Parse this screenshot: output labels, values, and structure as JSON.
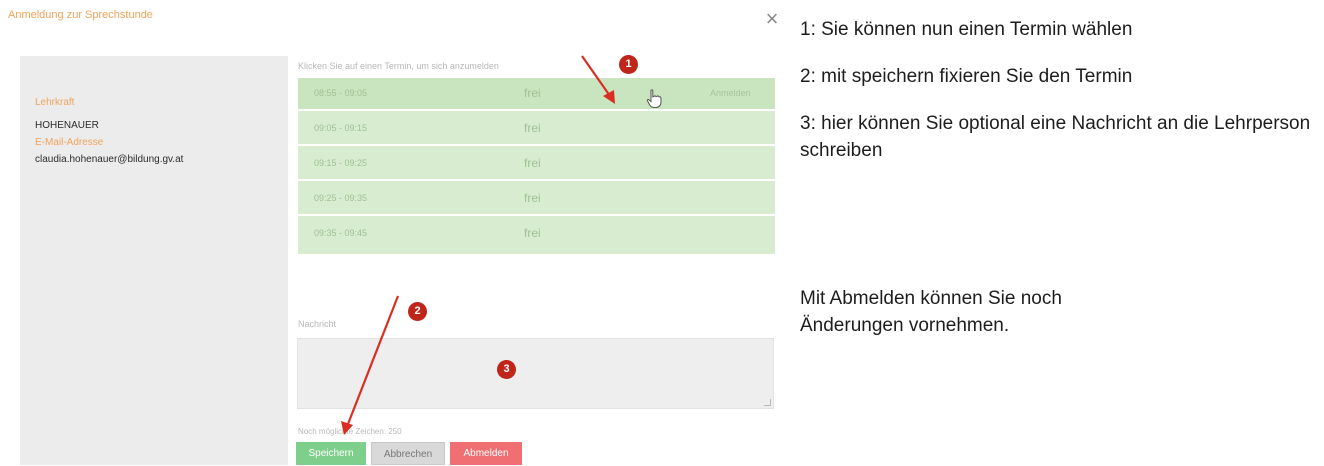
{
  "modal": {
    "title": "Anmeldung zur Sprechstunde",
    "close_glyph": "×"
  },
  "teacher": {
    "role_label": "Lehrkraft",
    "name": "HOHENAUER",
    "email_label": "E-Mail-Adresse",
    "email": "claudia.hohenauer@bildung.gv.at"
  },
  "slots": {
    "hint": "Klicken Sie auf einen Termin, um sich anzumelden",
    "hover_action": "Anmelden",
    "rows": [
      {
        "time": "08:55 - 09:05",
        "status": "frei"
      },
      {
        "time": "09:05 - 09:15",
        "status": "frei"
      },
      {
        "time": "09:15 - 09:25",
        "status": "frei"
      },
      {
        "time": "09:25 - 09:35",
        "status": "frei"
      },
      {
        "time": "09:35 - 09:45",
        "status": "frei"
      }
    ]
  },
  "message": {
    "label": "Nachricht",
    "value": "",
    "char_count": "Noch möglichte Zeichen: 250"
  },
  "buttons": {
    "save": "Speichern",
    "cancel": "Abbrechen",
    "logout": "Abmelden"
  },
  "markers": {
    "one": "1",
    "two": "2",
    "three": "3"
  },
  "instructions": {
    "line1": "1: Sie können nun einen Termin wählen",
    "line2": "2: mit speichern fixieren Sie den Termin",
    "line3": "3: hier können Sie optional eine Nachricht an die Lehrperson schreiben",
    "line4": "Mit Abmelden können Sie noch Änderungen vornehmen."
  },
  "colors": {
    "accent_orange": "#f0a35a",
    "slot_green": "#d8edd0",
    "save_green": "#7fcf8c",
    "logout_red": "#ef6f73",
    "annotation_red": "#c0251a"
  }
}
